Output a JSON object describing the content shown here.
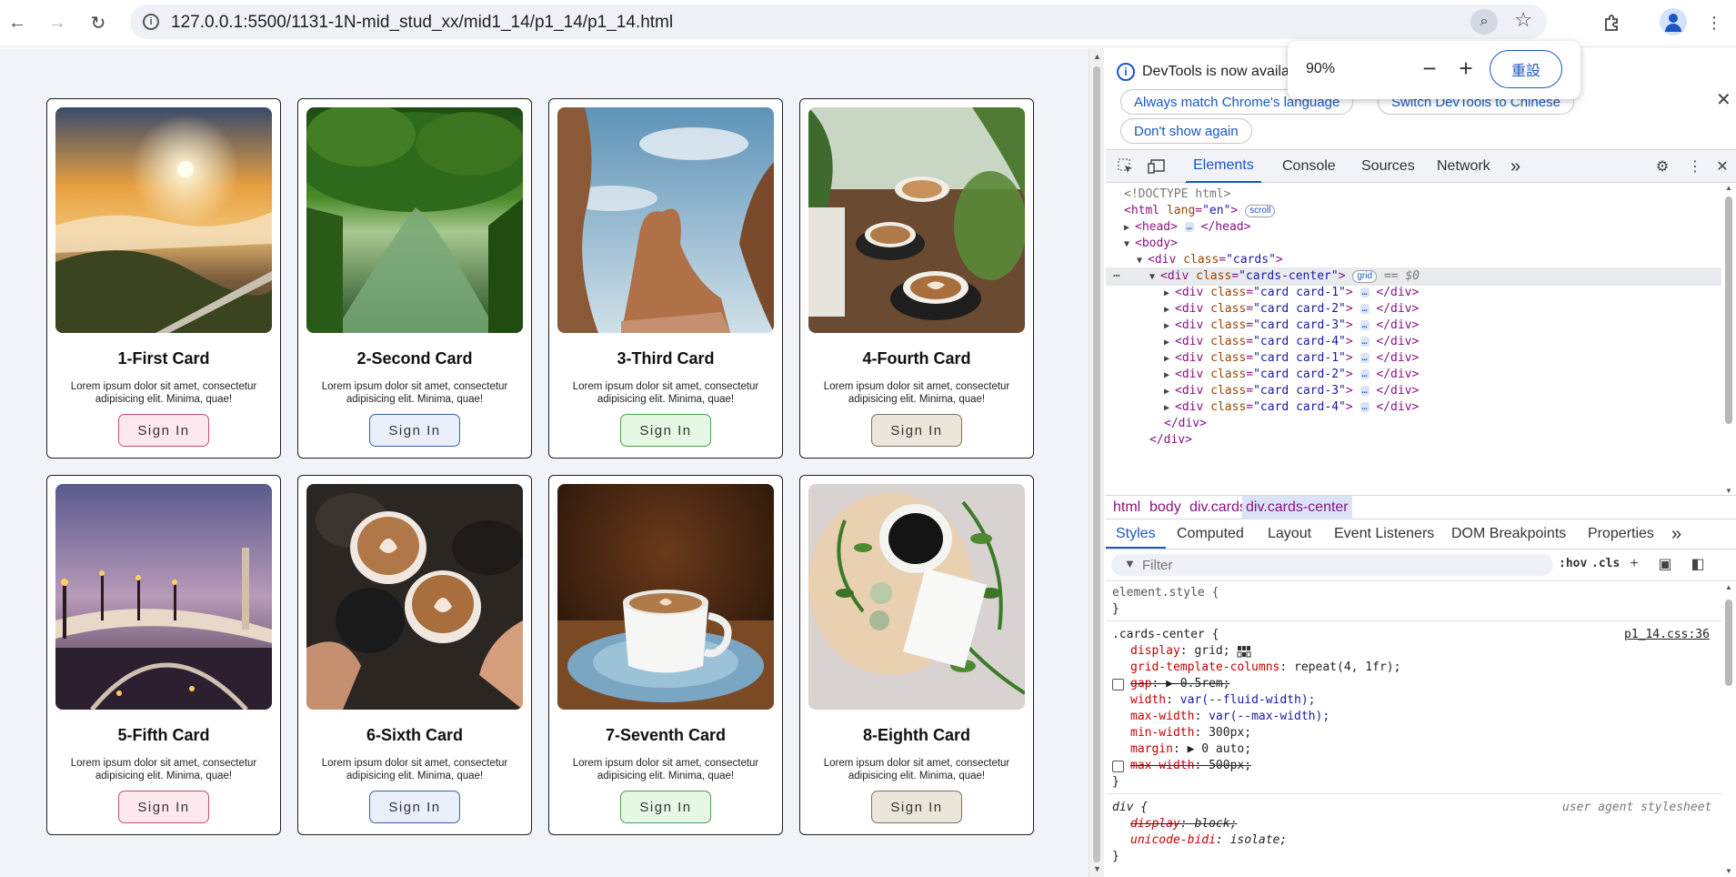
{
  "browser": {
    "url": "127.0.0.1:5500/1131-1N-mid_stud_xx/mid1_14/p1_14/p1_14.html",
    "zoom_level": "90%",
    "zoom_reset_label": "重設",
    "zoom_minus": "−",
    "zoom_plus": "+"
  },
  "page": {
    "cards": [
      {
        "title": "1-First Card",
        "text": "Lorem ipsum dolor sit amet, consectetur adipisicing elit. Minima, quae!",
        "button": "Sign In",
        "btn_border": "#c0506e",
        "btn_bg": "#fde8ee",
        "image": "sunrise-mountains"
      },
      {
        "title": "2-Second Card",
        "text": "Lorem ipsum dolor sit amet, consectetur adipisicing elit. Minima, quae!",
        "button": "Sign In",
        "btn_border": "#3c5fa0",
        "btn_bg": "#eaf0fb",
        "image": "forest-river"
      },
      {
        "title": "3-Third Card",
        "text": "Lorem ipsum dolor sit amet, consectetur adipisicing elit. Minima, quae!",
        "button": "Sign In",
        "btn_border": "#4ea04e",
        "btn_bg": "#e4f8e4",
        "image": "rock-formation"
      },
      {
        "title": "4-Fourth Card",
        "text": "Lorem ipsum dolor sit amet, consectetur adipisicing elit. Minima, quae!",
        "button": "Sign In",
        "btn_border": "#7d7260",
        "btn_bg": "#ece6da",
        "image": "coffee-cups-plants"
      },
      {
        "title": "5-Fifth Card",
        "text": "Lorem ipsum dolor sit amet, consectetur adipisicing elit. Minima, quae!",
        "button": "Sign In",
        "btn_border": "#c0506e",
        "btn_bg": "#fde8ee",
        "image": "bridge-dusk"
      },
      {
        "title": "6-Sixth Card",
        "text": "Lorem ipsum dolor sit amet, consectetur adipisicing elit. Minima, quae!",
        "button": "Sign In",
        "btn_border": "#3c5fa0",
        "btn_bg": "#eaf0fb",
        "image": "coffee-cheers"
      },
      {
        "title": "7-Seventh Card",
        "text": "Lorem ipsum dolor sit amet, consectetur adipisicing elit. Minima, quae!",
        "button": "Sign In",
        "btn_border": "#4ea04e",
        "btn_bg": "#e4f8e4",
        "image": "espresso-cup"
      },
      {
        "title": "8-Eighth Card",
        "text": "Lorem ipsum dolor sit amet, consectetur adipisicing elit. Minima, quae!",
        "button": "Sign In",
        "btn_border": "#7d7260",
        "btn_bg": "#ece6da",
        "image": "coffee-flatlay"
      }
    ]
  },
  "devtools": {
    "banner_message": "DevTools is now availab",
    "banner_btn_match": "Always match Chrome's language",
    "banner_btn_switch": "Switch DevTools to Chinese",
    "banner_btn_dont": "Don't show again",
    "tabs": {
      "elements": "Elements",
      "console": "Console",
      "sources": "Sources",
      "network": "Network",
      "more": "»"
    },
    "dom": {
      "doctype": "<!DOCTYPE html>",
      "html_lang": "\"en\"",
      "scroll_badge": "scroll",
      "grid_badge": "grid",
      "selected_marker": "== $0",
      "ellipsis": "…",
      "cards_class": "\"cards\"",
      "center_class": "\"cards-center\"",
      "children": [
        "\"card card-1\"",
        "\"card card-2\"",
        "\"card card-3\"",
        "\"card card-4\"",
        "\"card card-1\"",
        "\"card card-2\"",
        "\"card card-3\"",
        "\"card card-4\""
      ]
    },
    "breadcrumbs": [
      "html",
      "body",
      "div.cards",
      "div.cards-center"
    ],
    "subtabs": {
      "styles": "Styles",
      "computed": "Computed",
      "layout": "Layout",
      "listeners": "Event Listeners",
      "dom_bp": "DOM Breakpoints",
      "properties": "Properties",
      "more": "»"
    },
    "filter_placeholder": "Filter",
    "filter_hov": ":hov",
    "filter_cls": ".cls",
    "styles": {
      "element_style": "element.style {",
      "close_brace": "}",
      "rule_selector": ".cards-center {",
      "rule_source": "p1_14.css:36",
      "display": "grid;",
      "gtc": "repeat(4, 1fr);",
      "gap": "0.5rem;",
      "width": "var(--fluid-width);",
      "max_width1": "var(--max-width);",
      "min_width": "300px;",
      "margin": "0 auto;",
      "max_width2": "500px;",
      "ua_selector": "div {",
      "ua_label": "user agent stylesheet",
      "ua_display": "block;",
      "ua_unicode": "isolate;"
    }
  }
}
